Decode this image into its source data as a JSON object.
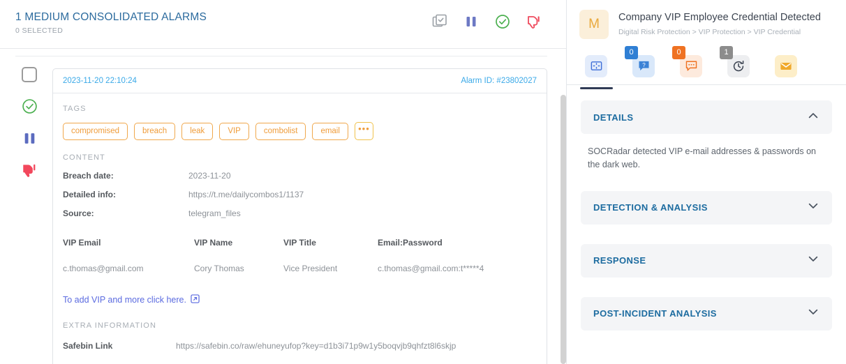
{
  "left": {
    "header": {
      "title": "1 MEDIUM CONSOLIDATED ALARMS",
      "subtitle": "0 SELECTED",
      "actions": [
        {
          "name": "bulk-select-icon",
          "label": "Bulk select"
        },
        {
          "name": "pause-icon",
          "label": "Pause"
        },
        {
          "name": "resolve-icon",
          "label": "Resolve"
        },
        {
          "name": "false-positive-icon",
          "label": "False positive"
        }
      ]
    },
    "rail": [
      {
        "name": "row-checkbox",
        "label": "Select alarm"
      },
      {
        "name": "resolve-icon",
        "label": "Resolve"
      },
      {
        "name": "pause-icon",
        "label": "Pause"
      },
      {
        "name": "false-positive-icon",
        "label": "False positive"
      }
    ],
    "card": {
      "date": "2023-11-20 22:10:24",
      "alarm_id": "Alarm ID: #23802027",
      "tags_label": "TAGS",
      "tags": [
        "compromised",
        "breach",
        "leak",
        "VIP",
        "combolist",
        "email"
      ],
      "tags_more": "•••",
      "content_label": "CONTENT",
      "content_fields": [
        {
          "key": "Breach date:",
          "value": "2023-11-20"
        },
        {
          "key": "Detailed info:",
          "value": "https://t.me/dailycombos1/1137"
        },
        {
          "key": "Source:",
          "value": "telegram_files"
        }
      ],
      "table": {
        "headers": [
          "VIP Email",
          "VIP Name",
          "VIP Title",
          "Email:Password"
        ],
        "rows": [
          [
            "c.thomas@gmail.com",
            "Cory Thomas",
            "Vice President",
            "c.thomas@gmail.com:t*****4"
          ]
        ]
      },
      "vip_link": "To add VIP and more click here.",
      "extra_label": "EXTRA INFORMATION",
      "extra_fields": [
        {
          "key": "Safebin Link",
          "value": "https://safebin.co/raw/ehuneyufop?key=d1b3i71p9w1y5boqvjb9qhfzt8l6skjp"
        }
      ]
    }
  },
  "right": {
    "avatar_letter": "M",
    "title": "Company VIP Employee Credential Detected",
    "breadcrumb": "Digital Risk Protection > VIP Protection > VIP Credential",
    "tabs": [
      {
        "name": "tab-details",
        "icon": "expand-icon",
        "badge": null,
        "active": true
      },
      {
        "name": "tab-questions",
        "icon": "question-bubble-icon",
        "badge": "0",
        "badge_color": "#2f7fd4"
      },
      {
        "name": "tab-comments",
        "icon": "comment-bubble-icon",
        "badge": "0",
        "badge_color": "#ef7222"
      },
      {
        "name": "tab-history",
        "icon": "history-clock-icon",
        "badge": "1",
        "badge_color": "#8c8c8c"
      },
      {
        "name": "tab-mail",
        "icon": "envelope-icon",
        "badge": null
      }
    ],
    "sections": [
      {
        "title": "DETAILS",
        "expanded": true,
        "body": "SOCRadar detected VIP e-mail addresses & passwords on the dark web."
      },
      {
        "title": "DETECTION & ANALYSIS",
        "expanded": false,
        "body": ""
      },
      {
        "title": "RESPONSE",
        "expanded": false,
        "body": ""
      },
      {
        "title": "POST-INCIDENT ANALYSIS",
        "expanded": false,
        "body": ""
      }
    ]
  },
  "colors": {
    "accent_blue": "#2c6b9e",
    "tag_orange": "#ef9c3a",
    "link_blue": "#3aa9e8",
    "green": "#4cb050",
    "red": "#ef4b5e",
    "pause_blue": "#5b6bbf"
  }
}
